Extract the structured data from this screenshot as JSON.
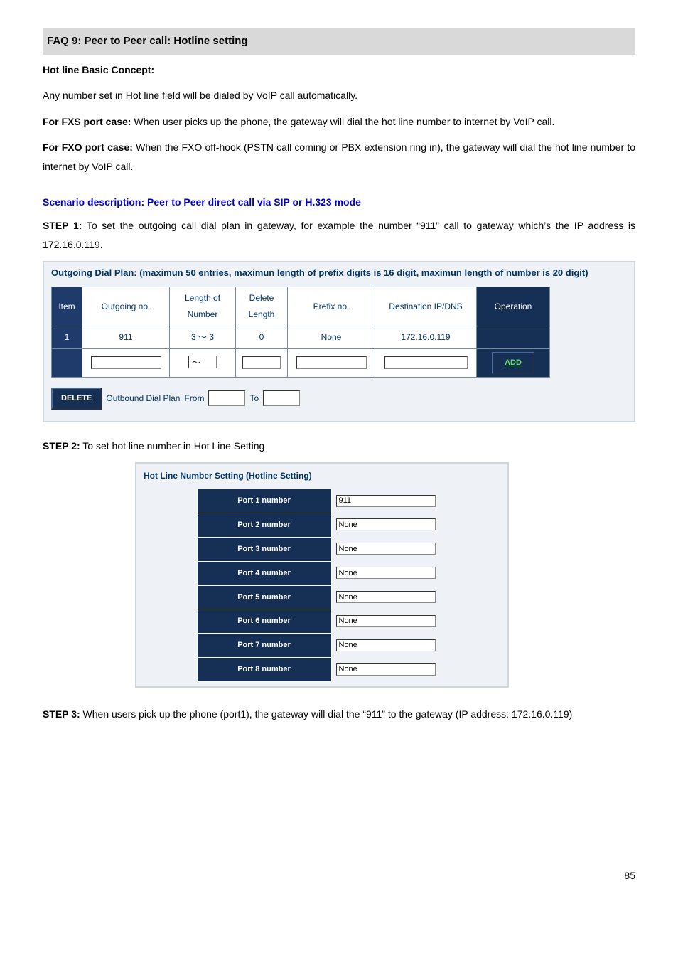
{
  "faq_title": "FAQ 9: Peer to Peer call: Hotline setting",
  "hotline_concept_label": "Hot line Basic Concept:",
  "hotline_concept_text": "Any number set in Hot line field will be dialed by VoIP call automatically.",
  "fxs_label": "For FXS port case:",
  "fxs_text": " When user picks up the phone, the gateway will dial the hot line number to internet by VoIP call.",
  "fxo_label": "For FXO port case:",
  "fxo_text": " When the FXO off-hook (PSTN call coming or PBX extension ring in), the gateway will dial the hot line number to internet by VoIP call.",
  "scenario": "Scenario description: Peer to Peer direct call via SIP or H.323 mode",
  "step1_label": "STEP 1:",
  "step1_text": " To set the outgoing call dial plan in gateway, for example the number “911” call to gateway which’s the IP address is 172.16.0.119.",
  "dial_caption": "Outgoing Dial Plan: (maximun 50 entries, maximun length of prefix digits is 16 digit, maximun length of number is 20 digit)",
  "dial_headers": {
    "item": "Item",
    "outgoing": "Outgoing no.",
    "length": "Length of Number",
    "delete": "Delete Length",
    "prefix": "Prefix no.",
    "dest": "Destination IP/DNS",
    "op": "Operation"
  },
  "dial_row": {
    "item": "1",
    "outgoing": "911",
    "length": "3 ～ 3",
    "delete": "0",
    "prefix": "None",
    "dest": "172.16.0.119"
  },
  "tilde": "～",
  "add_label": "ADD",
  "delete_label": "DELETE",
  "outbound_label": "Outbound Dial Plan",
  "from_label": "From",
  "to_label": "To",
  "step2_label": "STEP 2:",
  "step2_text": " To set hot line number in Hot Line Setting",
  "hotline_caption": "Hot Line Number Setting (Hotline Setting)",
  "hotline_rows": [
    {
      "label": "Port 1 number",
      "value": "911"
    },
    {
      "label": "Port 2 number",
      "value": "None"
    },
    {
      "label": "Port 3 number",
      "value": "None"
    },
    {
      "label": "Port 4 number",
      "value": "None"
    },
    {
      "label": "Port 5 number",
      "value": "None"
    },
    {
      "label": "Port 6 number",
      "value": "None"
    },
    {
      "label": "Port 7 number",
      "value": "None"
    },
    {
      "label": "Port 8 number",
      "value": "None"
    }
  ],
  "step3_label": "STEP 3:",
  "step3_text": "  When users pick up the phone (port1), the gateway will dial the “911” to the gateway (IP address: 172.16.0.119)",
  "page_number": "85"
}
